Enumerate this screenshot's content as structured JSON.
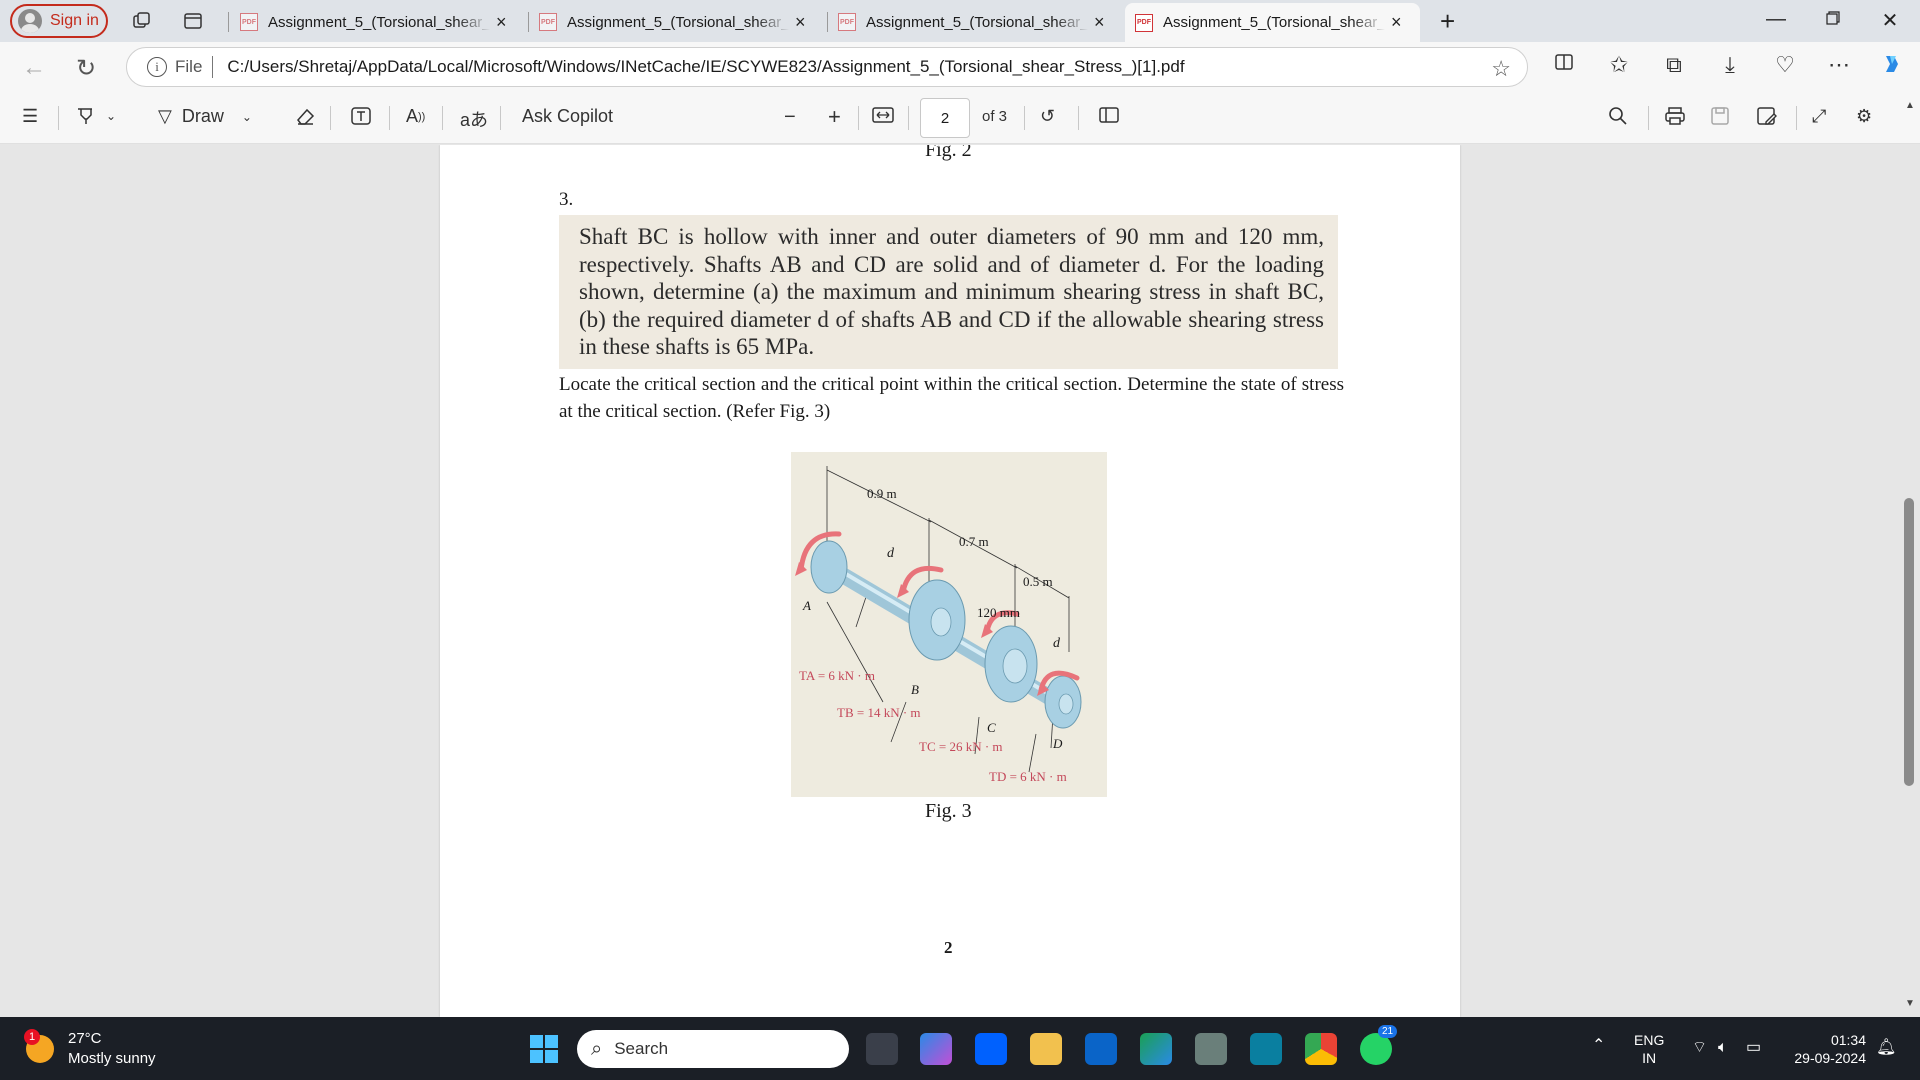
{
  "browser": {
    "signin_label": "Sign in",
    "tabs": [
      {
        "title": "Assignment_5_(Torsional_shear_Stress_)[1].pdf",
        "icon_text": "PDF",
        "active": false
      },
      {
        "title": "Assignment_5_(Torsional_shear_Stress_)[1].pdf",
        "icon_text": "PDF",
        "active": false
      },
      {
        "title": "Assignment_5_(Torsional_shear_Stress_)[1].pdf",
        "icon_text": "PDF",
        "active": false
      },
      {
        "title": "Assignment_5_(Torsional_shear_Stress_)[1].pdf",
        "icon_text": "PDF",
        "active": true
      }
    ],
    "tab_close": "×",
    "new_tab": "+",
    "address": {
      "prefix": "File",
      "url": "C:/Users/Shretaj/AppData/Local/Microsoft/Windows/INetCache/IE/SCYWE823/Assignment_5_(Torsional_shear_Stress_)[1].pdf"
    }
  },
  "pdf_toolbar": {
    "draw_label": "Draw",
    "ask_copilot_label": "Ask Copilot",
    "read_aloud": "A",
    "translate": "aあ",
    "current_page": "2",
    "page_total_label": "of 3"
  },
  "document": {
    "fig_top_caption": "Fig. 2",
    "question_number": "3.",
    "problem_text": "Shaft BC is hollow with inner and outer diameters of 90 mm and 120 mm, respectively. Shafts AB and CD are solid and of diameter d. For the loading shown, determine (a) the maximum and minimum shearing stress in shaft BC, (b) the required diameter d of shafts AB and CD if the allowable shearing stress in these shafts is 65 MPa.",
    "instruction_text": "Locate the critical section and the critical point within the critical section. Determine the state of stress at the critical section. (Refer Fig. 3)",
    "figure": {
      "dim_ab": "0.9 m",
      "dim_bc": "0.7 m",
      "dim_cd": "0.5 m",
      "dim_120": "120 mm",
      "label_d1": "d",
      "label_d2": "d",
      "label_a": "A",
      "label_b": "B",
      "label_c": "C",
      "label_d": "D",
      "torque_a": "TA = 6 kN · m",
      "torque_b": "TB = 14 kN · m",
      "torque_c": "TC = 26 kN · m",
      "torque_d": "TD = 6 kN · m"
    },
    "fig_caption": "Fig. 3",
    "page_number": "2"
  },
  "taskbar": {
    "weather_badge": "1",
    "temperature": "27°C",
    "condition": "Mostly sunny",
    "search_label": "Search",
    "whatsapp_badge": "21",
    "language_top": "ENG",
    "language_bottom": "IN",
    "time": "01:34",
    "date": "29-09-2024"
  },
  "colors": {
    "accent_red": "#c42b1c",
    "taskbar_bg": "#1b1f26",
    "problem_bg": "#efeae0",
    "torque_arrow": "#e8737a"
  }
}
